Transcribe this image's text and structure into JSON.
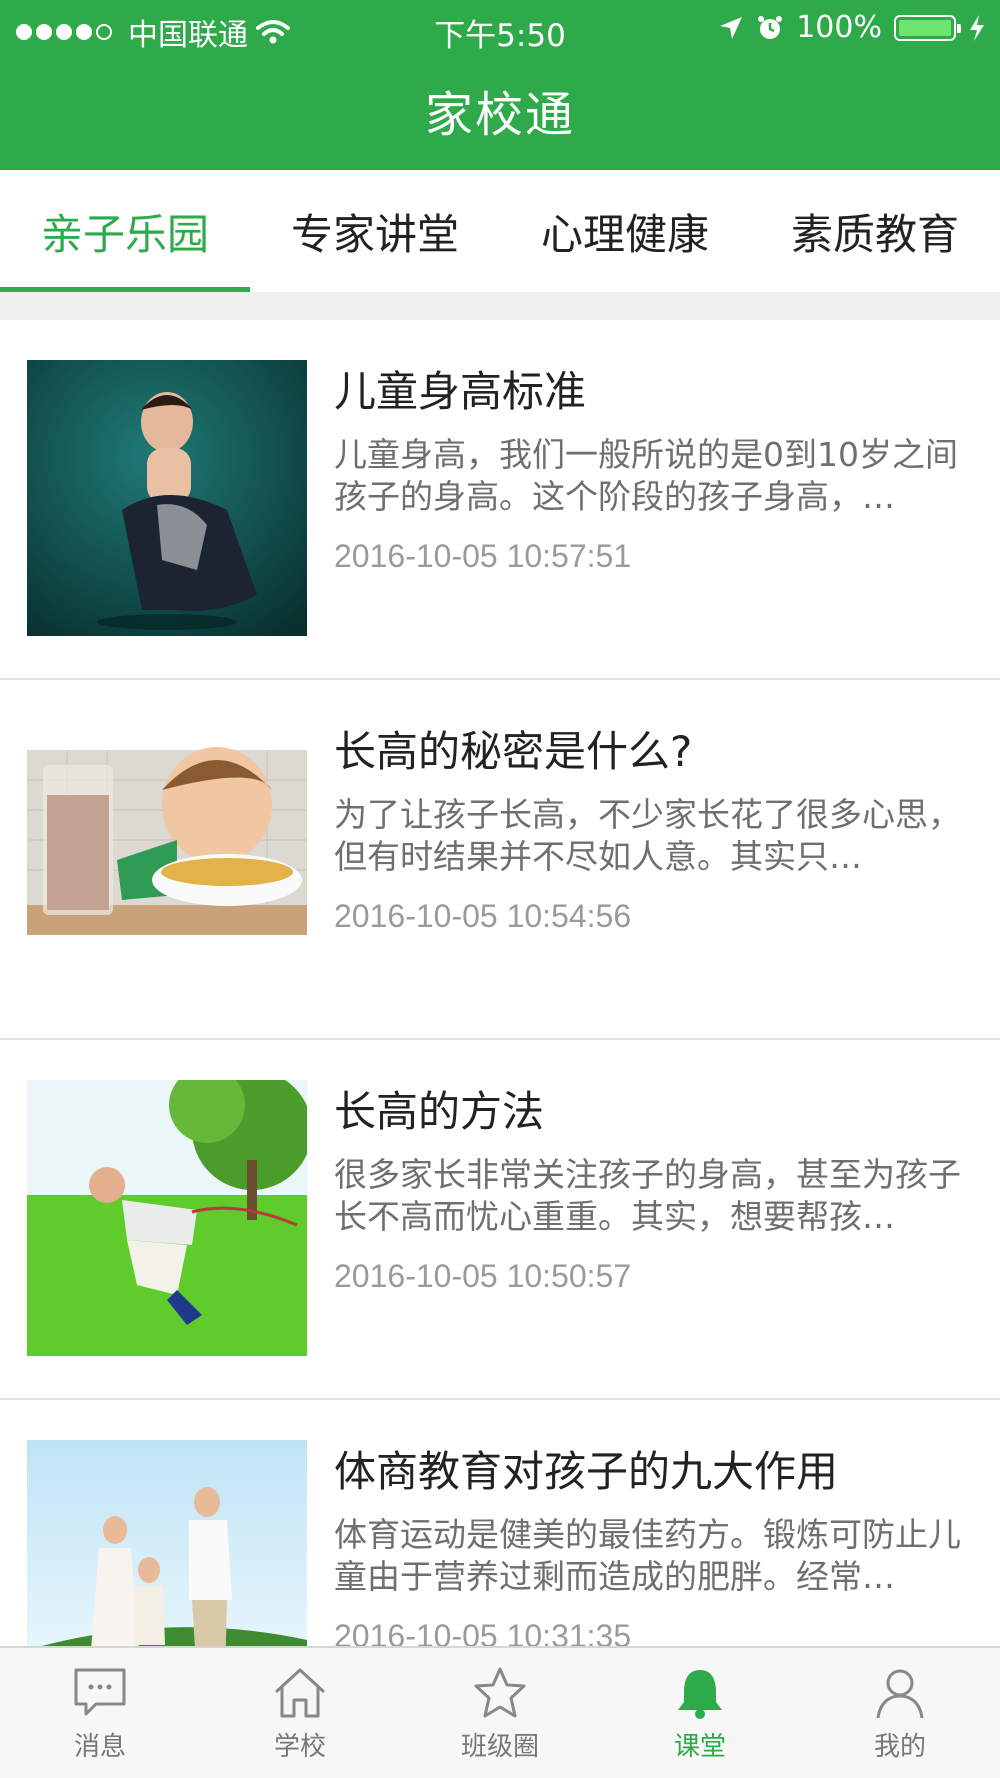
{
  "status_bar": {
    "carrier": "中国联通",
    "time": "下午5:50",
    "battery": "100%"
  },
  "header": {
    "title": "家校通"
  },
  "tabs": [
    {
      "label": "亲子乐园",
      "active": true
    },
    {
      "label": "专家讲堂",
      "active": false
    },
    {
      "label": "心理健康",
      "active": false
    },
    {
      "label": "素质教育",
      "active": false
    }
  ],
  "articles": [
    {
      "title": "儿童身高标准",
      "summary": "儿童身高，我们一般所说的是0到10岁之间孩子的身高。这个阶段的孩子身高，…",
      "time": "2016-10-05 10:57:51"
    },
    {
      "title": "长高的秘密是什么?",
      "summary": "为了让孩子长高，不少家长花了很多心思，但有时结果并不尽如人意。其实只…",
      "time": "2016-10-05 10:54:56"
    },
    {
      "title": "长高的方法",
      "summary": "很多家长非常关注孩子的身高，甚至为孩子长不高而忧心重重。其实，想要帮孩…",
      "time": "2016-10-05 10:50:57"
    },
    {
      "title": "体商教育对孩子的九大作用",
      "summary": "体育运动是健美的最佳药方。锻炼可防止儿童由于营养过剩而造成的肥胖。经常…",
      "time": "2016-10-05 10:31:35"
    }
  ],
  "tabbar": [
    {
      "label": "消息",
      "icon": "chat-bubble-icon",
      "active": false
    },
    {
      "label": "学校",
      "icon": "home-icon",
      "active": false
    },
    {
      "label": "班级圈",
      "icon": "star-icon",
      "active": false
    },
    {
      "label": "课堂",
      "icon": "bell-icon",
      "active": true
    },
    {
      "label": "我的",
      "icon": "person-icon",
      "active": false
    }
  ],
  "colors": {
    "brand": "#2eaa4b"
  }
}
